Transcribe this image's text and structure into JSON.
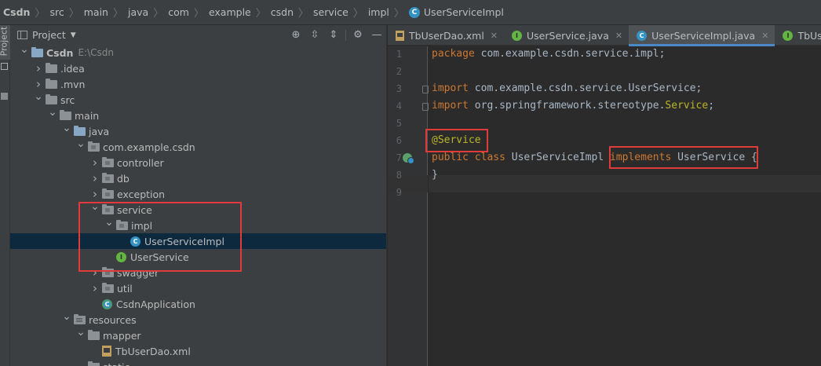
{
  "breadcrumb": [
    "Csdn",
    "src",
    "main",
    "java",
    "com",
    "example",
    "csdn",
    "service",
    "impl",
    "UserServiceImpl"
  ],
  "side_tab": "Project",
  "project_panel": {
    "title": "Project",
    "toolbar_icons": [
      "locate-icon",
      "expand-all-icon",
      "collapse-all-icon",
      "gear-icon",
      "hide-icon"
    ]
  },
  "tree": [
    {
      "label": "Csdn",
      "hint": "E:\\Csdn",
      "depth": 0,
      "arrow": "down",
      "icon": "module-folder"
    },
    {
      "label": ".idea",
      "depth": 1,
      "arrow": "right",
      "icon": "folder"
    },
    {
      "label": ".mvn",
      "depth": 1,
      "arrow": "right",
      "icon": "folder"
    },
    {
      "label": "src",
      "depth": 1,
      "arrow": "down",
      "icon": "folder"
    },
    {
      "label": "main",
      "depth": 2,
      "arrow": "down",
      "icon": "folder"
    },
    {
      "label": "java",
      "depth": 3,
      "arrow": "down",
      "icon": "source-folder"
    },
    {
      "label": "com.example.csdn",
      "depth": 4,
      "arrow": "down",
      "icon": "package"
    },
    {
      "label": "controller",
      "depth": 5,
      "arrow": "right",
      "icon": "package"
    },
    {
      "label": "db",
      "depth": 5,
      "arrow": "right",
      "icon": "package"
    },
    {
      "label": "exception",
      "depth": 5,
      "arrow": "right",
      "icon": "package"
    },
    {
      "label": "service",
      "depth": 5,
      "arrow": "down",
      "icon": "package"
    },
    {
      "label": "impl",
      "depth": 6,
      "arrow": "down",
      "icon": "package"
    },
    {
      "label": "UserServiceImpl",
      "depth": 7,
      "arrow": "",
      "icon": "class",
      "selected": true
    },
    {
      "label": "UserService",
      "depth": 6,
      "arrow": "",
      "icon": "interface"
    },
    {
      "label": "swagger",
      "depth": 5,
      "arrow": "right",
      "icon": "package"
    },
    {
      "label": "util",
      "depth": 5,
      "arrow": "right",
      "icon": "package"
    },
    {
      "label": "CsdnApplication",
      "depth": 5,
      "arrow": "",
      "icon": "spring-app"
    },
    {
      "label": "resources",
      "depth": 3,
      "arrow": "down",
      "icon": "resources-folder"
    },
    {
      "label": "mapper",
      "depth": 4,
      "arrow": "down",
      "icon": "folder"
    },
    {
      "label": "TbUserDao.xml",
      "depth": 5,
      "arrow": "",
      "icon": "xml-file"
    },
    {
      "label": "static",
      "depth": 4,
      "arrow": "",
      "icon": "folder"
    }
  ],
  "tabs": [
    {
      "label": "TbUserDao.xml",
      "icon": "xml",
      "active": false
    },
    {
      "label": "UserService.java",
      "icon": "interface",
      "active": false
    },
    {
      "label": "UserServiceImpl.java",
      "icon": "class",
      "active": true
    },
    {
      "label": "TbUserDao.j",
      "icon": "interface",
      "active": false
    }
  ],
  "editor": {
    "line_numbers": [
      "1",
      "2",
      "3",
      "4",
      "5",
      "6",
      "7",
      "8",
      "9"
    ],
    "lines": [
      [
        {
          "t": "package",
          "c": "kw"
        },
        {
          "t": " com.example.csdn.service.impl;",
          "c": ""
        }
      ],
      [],
      [
        {
          "t": "import",
          "c": "kw"
        },
        {
          "t": " com.example.csdn.service.UserService;",
          "c": ""
        }
      ],
      [
        {
          "t": "import",
          "c": "kw"
        },
        {
          "t": " org.springframework.stereotype.",
          "c": ""
        },
        {
          "t": "Service",
          "c": "ann"
        },
        {
          "t": ";",
          "c": ""
        }
      ],
      [],
      [
        {
          "t": "@Service",
          "c": "ann"
        }
      ],
      [
        {
          "t": "public",
          "c": "kw"
        },
        {
          "t": " ",
          "c": ""
        },
        {
          "t": "class",
          "c": "kw"
        },
        {
          "t": " UserServiceImpl ",
          "c": ""
        },
        {
          "t": "implements",
          "c": "kw"
        },
        {
          "t": " UserService",
          "c": ""
        },
        {
          "t": " {",
          "c": ""
        }
      ],
      [
        {
          "t": "}",
          "c": ""
        }
      ],
      []
    ]
  }
}
